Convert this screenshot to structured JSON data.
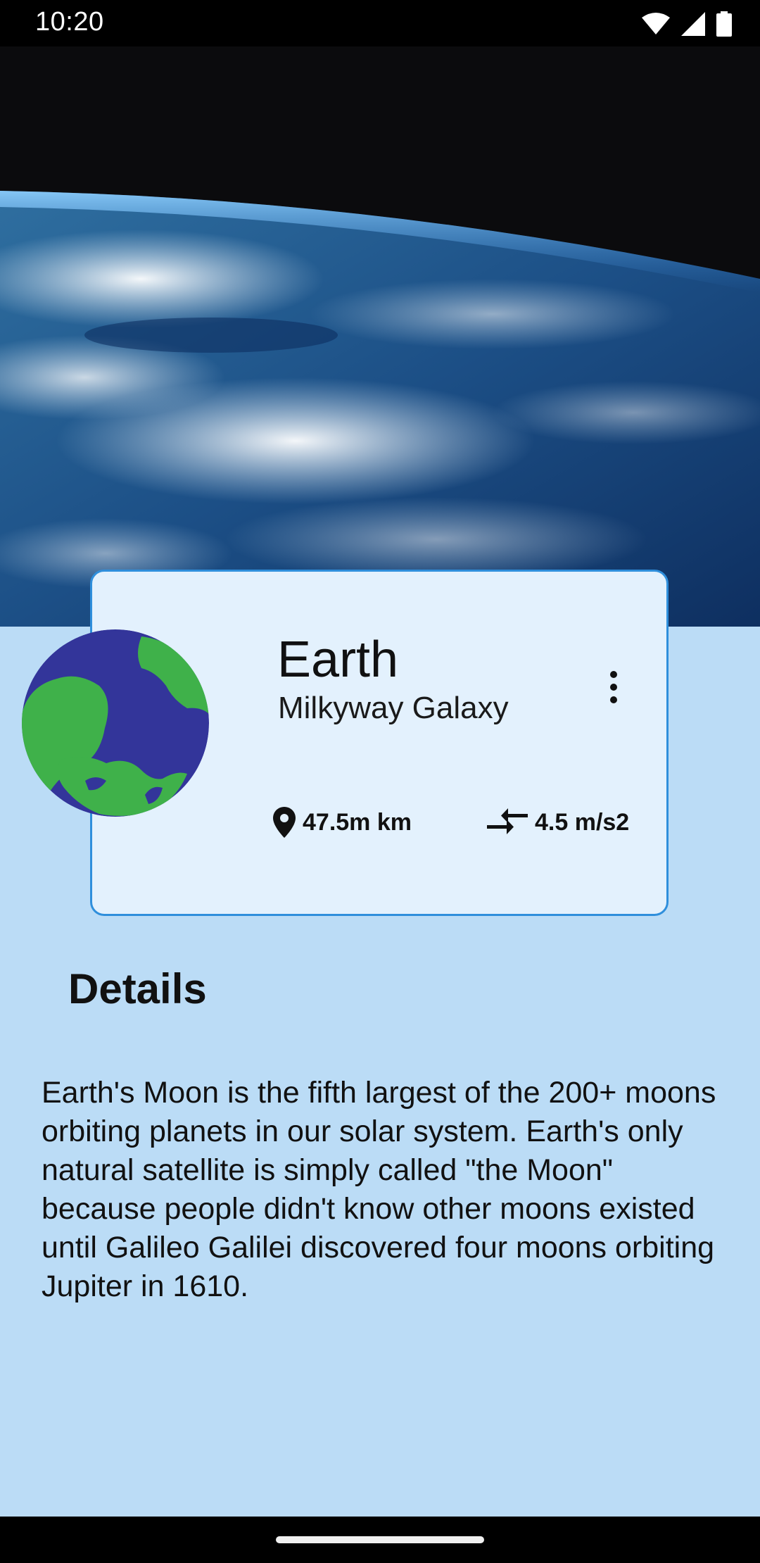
{
  "status_bar": {
    "time": "10:20"
  },
  "planet": {
    "name": "Earth",
    "galaxy": "Milkyway Galaxy",
    "distance": "47.5m km",
    "gravity": "4.5 m/s2"
  },
  "details": {
    "heading": "Details",
    "text": "Earth's Moon is the fifth largest of the 200+ moons orbiting planets in our solar system. Earth's only natural satellite is simply called \"the Moon\" because people didn't know other moons existed until Galileo Galilei discovered four moons orbiting Jupiter in 1610."
  },
  "icons": {
    "wifi": "wifi-icon",
    "signal": "signal-icon",
    "battery": "battery-icon",
    "menu": "more-vert-icon",
    "location": "location-pin-icon",
    "gravity": "compare-arrows-icon"
  },
  "colors": {
    "background": "#bbdcf6",
    "card_background": "#e3f1fd",
    "card_border": "#2f8fdc",
    "planet_ocean": "#33359a",
    "planet_land": "#3fb14a"
  }
}
